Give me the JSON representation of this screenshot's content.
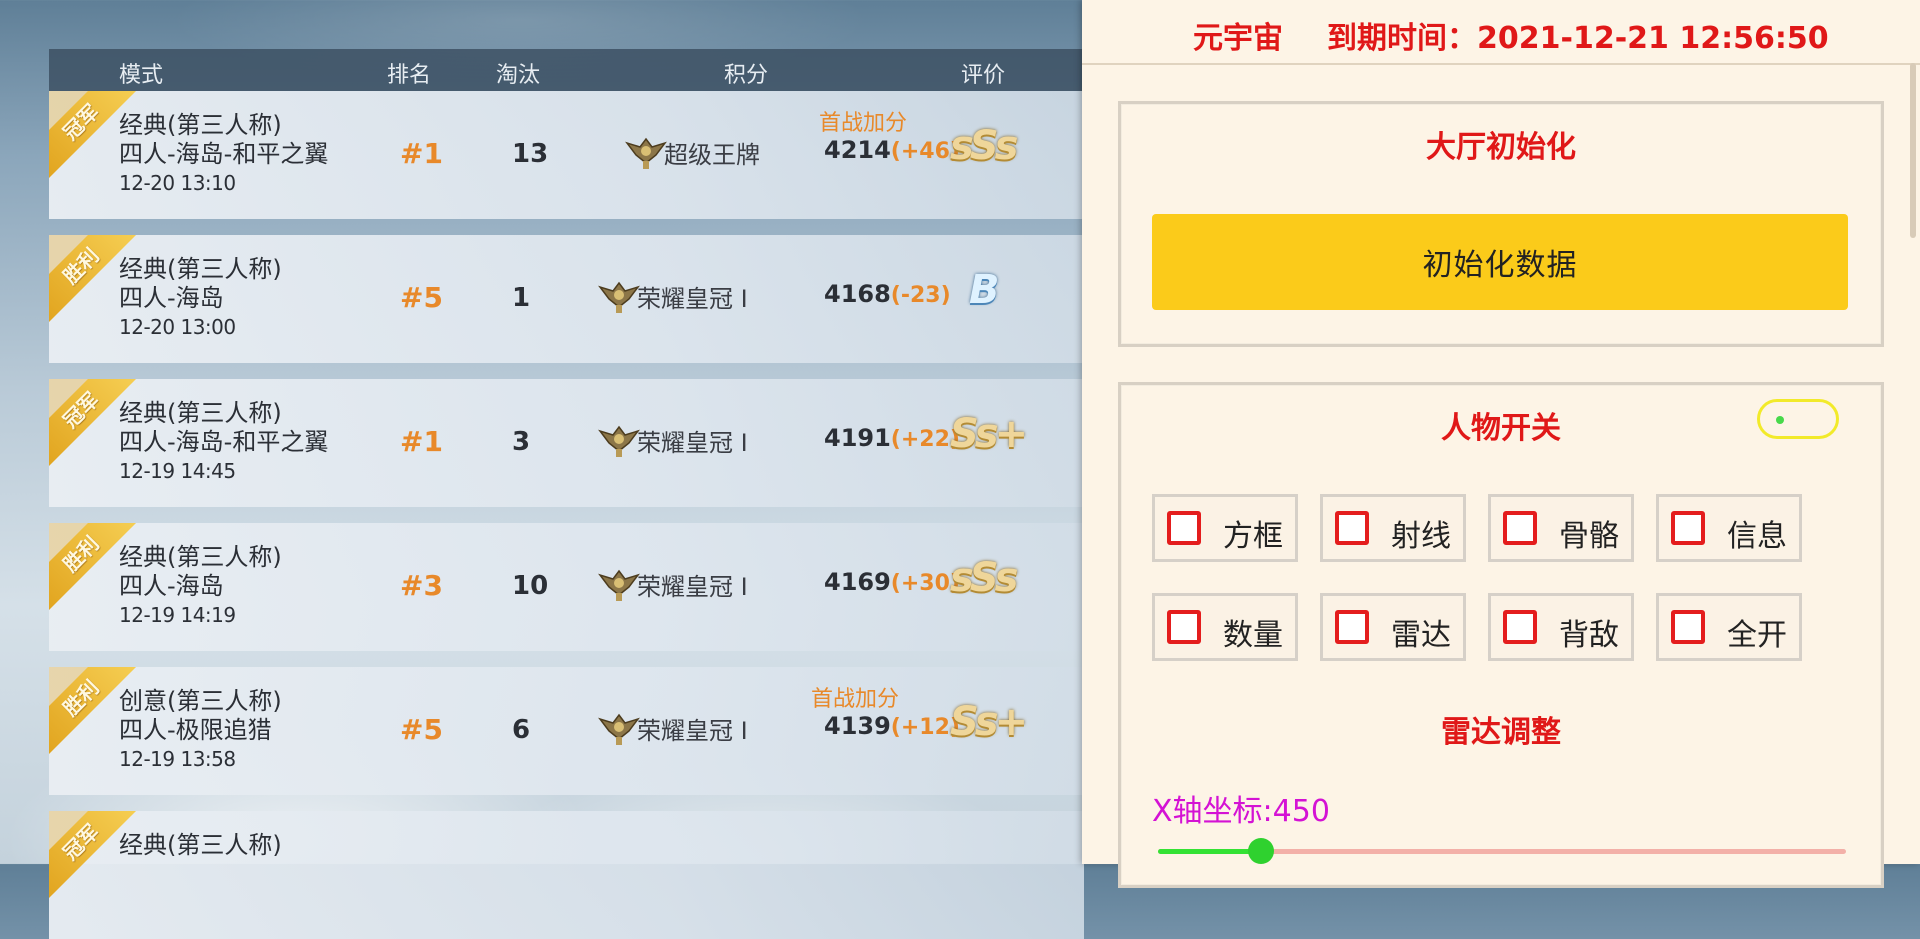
{
  "table": {
    "headers": {
      "mode": "模式",
      "rank": "排名",
      "kills": "淘汰",
      "score": "积分",
      "rating": "评价"
    },
    "rows": [
      {
        "badge": "冠军",
        "mode_line1": "经典(第三人称)",
        "mode_line2": "四人-海岛-和平之翼",
        "time": "12-20 13:10",
        "rank": "#1",
        "kills": "13",
        "bonus": "首战加分",
        "tier": "超级王牌",
        "score": "4214",
        "delta": "(+46)",
        "grade": "sSs",
        "grade_color": "gold"
      },
      {
        "badge": "胜利",
        "mode_line1": "经典(第三人称)",
        "mode_line2": "四人-海岛",
        "time": "12-20 13:00",
        "rank": "#5",
        "kills": "1",
        "bonus": "",
        "tier": "荣耀皇冠 I",
        "score": "4168",
        "delta": "(-23)",
        "grade": "B",
        "grade_color": "blue"
      },
      {
        "badge": "冠军",
        "mode_line1": "经典(第三人称)",
        "mode_line2": "四人-海岛-和平之翼",
        "time": "12-19 14:45",
        "rank": "#1",
        "kills": "3",
        "bonus": "",
        "tier": "荣耀皇冠 I",
        "score": "4191",
        "delta": "(+22)",
        "grade": "Ss+",
        "grade_color": "gold"
      },
      {
        "badge": "胜利",
        "mode_line1": "经典(第三人称)",
        "mode_line2": "四人-海岛",
        "time": "12-19 14:19",
        "rank": "#3",
        "kills": "10",
        "bonus": "",
        "tier": "荣耀皇冠 I",
        "score": "4169",
        "delta": "(+30)",
        "grade": "sSs",
        "grade_color": "gold"
      },
      {
        "badge": "胜利",
        "mode_line1": "创意(第三人称)",
        "mode_line2": "四人-极限追猎",
        "time": "12-19 13:58",
        "rank": "#5",
        "kills": "6",
        "bonus": "首战加分",
        "tier": "荣耀皇冠 I",
        "score": "4139",
        "delta": "(+12)",
        "grade": "Ss+",
        "grade_color": "gold"
      },
      {
        "badge": "冠军",
        "mode_line1": "经典(第三人称)",
        "mode_line2": "",
        "time": "",
        "rank": "",
        "kills": "",
        "bonus": "",
        "tier": "",
        "score": "",
        "delta": "",
        "grade": "",
        "grade_color": "gold"
      }
    ]
  },
  "panel": {
    "app_name": "元宇宙",
    "expiry": "到期时间：2021-12-21 12:56:50",
    "lobby": {
      "title": "大厅初始化",
      "button_label": "初始化数据"
    },
    "player": {
      "title": "人物开关",
      "toggle_on": false,
      "options": [
        {
          "label": "方框",
          "checked": false
        },
        {
          "label": "射线",
          "checked": false
        },
        {
          "label": "骨骼",
          "checked": false
        },
        {
          "label": "信息",
          "checked": false
        },
        {
          "label": "数量",
          "checked": false
        },
        {
          "label": "雷达",
          "checked": false
        },
        {
          "label": "背敌",
          "checked": false
        },
        {
          "label": "全开",
          "checked": false
        }
      ]
    },
    "radar": {
      "title": "雷达调整",
      "x_label": "X轴坐标:450",
      "x_value": 450,
      "x_fraction": 0.15
    }
  },
  "colors": {
    "accent_red": "#e01818",
    "button_yellow": "#fbcb1a",
    "orange": "#e8892a",
    "slider_magenta": "#d412d4",
    "slider_green": "#34e234"
  },
  "icons": {
    "tier_emblem": "winged-emblem-icon",
    "checkbox": "checkbox-icon"
  }
}
